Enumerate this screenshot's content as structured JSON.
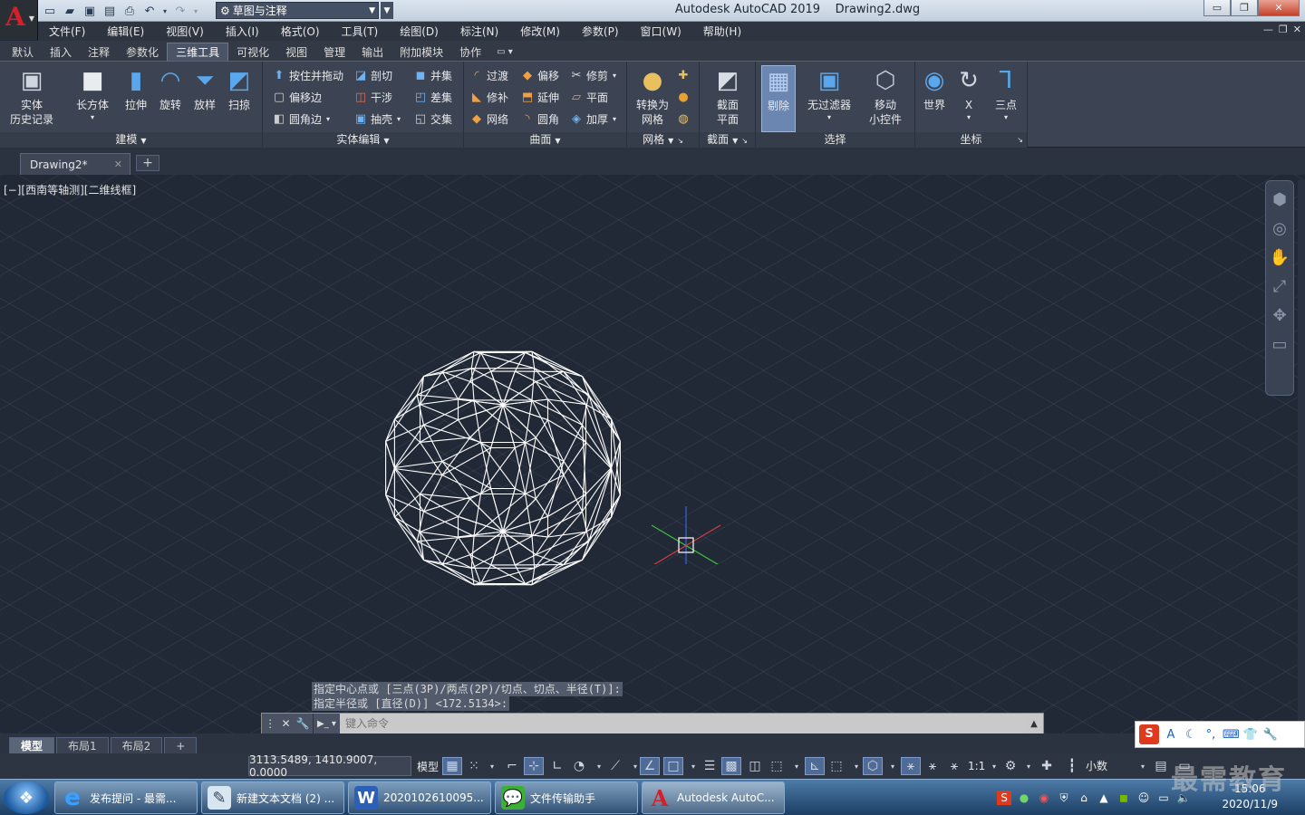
{
  "window": {
    "title": "Autodesk AutoCAD 2019    Drawing2.dwg",
    "workspace": "草图与注释",
    "controls": {
      "minimize": "▭",
      "restore": "❐",
      "close": "✕"
    }
  },
  "menubar": [
    "文件(F)",
    "编辑(E)",
    "视图(V)",
    "插入(I)",
    "格式(O)",
    "工具(T)",
    "绘图(D)",
    "标注(N)",
    "修改(M)",
    "参数(P)",
    "窗口(W)",
    "帮助(H)"
  ],
  "ribbon_tabs": [
    "默认",
    "插入",
    "注释",
    "参数化",
    "三维工具",
    "可视化",
    "视图",
    "管理",
    "输出",
    "附加模块",
    "协作"
  ],
  "ribbon_active_tab": "三维工具",
  "panels": {
    "modeling": {
      "title": "建模",
      "history": "实体\n历史记录",
      "box": "长方体",
      "extrude": "拉伸",
      "revolve": "旋转",
      "loft": "放样",
      "sweep": "扫掠"
    },
    "solid_edit": {
      "title": "实体编辑",
      "presspull": "按住并拖动",
      "offset_edge": "偏移边",
      "fillet_edge": "圆角边",
      "slice": "剖切",
      "interfere": "干涉",
      "shell": "抽壳",
      "union": "并集",
      "subtract": "差集",
      "intersect": "交集"
    },
    "surface": {
      "title": "曲面",
      "blend": "过渡",
      "patch": "修补",
      "network": "网络",
      "offset": "偏移",
      "extend": "延伸",
      "fillet": "圆角",
      "trim": "修剪",
      "planar": "平面",
      "thicken": "加厚"
    },
    "mesh": {
      "title": "网格",
      "convert": "转换为\n网格"
    },
    "section": {
      "title": "截面",
      "plane": "截面\n平面"
    },
    "selection": {
      "title": "选择",
      "cull": "剔除",
      "no_filter": "无过滤器",
      "gizmo": "移动\n小控件"
    },
    "coordinates": {
      "title": "坐标",
      "world": "世界",
      "x": "X",
      "three_point": "三点"
    }
  },
  "file_tab": "Drawing2*",
  "viewport": {
    "label": "[−][西南等轴测][二维线框]"
  },
  "command": {
    "history": [
      "指定中心点或 [三点(3P)/两点(2P)/切点、切点、半径(T)]:",
      "指定半径或 [直径(D)] <172.5134>:"
    ],
    "placeholder": "键入命令"
  },
  "layout_tabs": [
    "模型",
    "布局1",
    "布局2"
  ],
  "status": {
    "coords": "3113.5489, 1410.9007, 0.0000",
    "model": "模型",
    "scale": "1:1",
    "units": "小数"
  },
  "taskbar": {
    "items": [
      {
        "label": "发布提问 - 最需...",
        "icon": "ie-icon"
      },
      {
        "label": "新建文本文档 (2) ...",
        "icon": "notepad-icon"
      },
      {
        "label": "2020102610095...",
        "icon": "word-icon"
      },
      {
        "label": "文件传输助手",
        "icon": "wechat-icon"
      },
      {
        "label": "Autodesk AutoC...",
        "icon": "autocad-icon"
      }
    ],
    "time": "15:06",
    "date": "2020/11/9"
  },
  "watermark": "最需教育",
  "colors": {
    "viewport_bg": "#212836",
    "ucs_x": "#d04040",
    "ucs_y": "#40c040",
    "ucs_z": "#4060e0"
  }
}
